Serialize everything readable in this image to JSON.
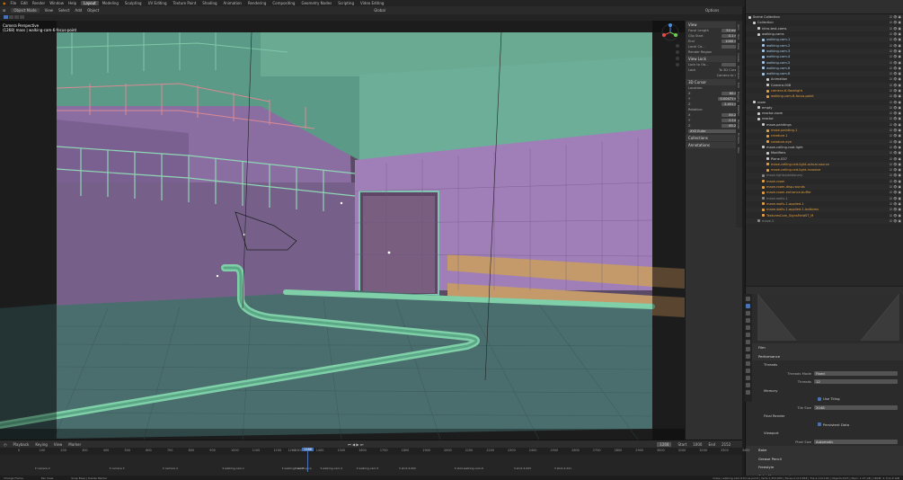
{
  "menu": {
    "items": [
      "File",
      "Edit",
      "Render",
      "Window",
      "Help"
    ],
    "workspaces": [
      "Layout",
      "Modeling",
      "Sculpting",
      "UV Editing",
      "Texture Paint",
      "Shading",
      "Animation",
      "Rendering",
      "Compositing",
      "Geometry Nodes",
      "Scripting",
      "Video Editing"
    ],
    "active_workspace": "Layout",
    "scene_label": "Scene",
    "view_layer_label": "part 1"
  },
  "viewport_header": {
    "mode": "Object Mode",
    "menus": [
      "View",
      "Select",
      "Add",
      "Object"
    ],
    "transform": "Global",
    "options": "Options"
  },
  "viewport": {
    "camera_name": "Camera Perspective",
    "camera_path": "(1268) mass | walking-cam-6-focus-point"
  },
  "npanel": {
    "view_header": "View",
    "focal_label": "Focal Length",
    "focal_value": "50 mm",
    "clip_start_label": "Clip Start",
    "clip_start_value": "0.1 m",
    "end_label": "End",
    "end_value": "1000 m",
    "local_camera_label": "Local Ca...",
    "render_region_label": "Render Region",
    "view_lock_header": "View Lock",
    "lock_to_object_label": "Lock to Ob...",
    "lock_label": "Lock",
    "to_3d_cursor_label": "To 3D Cursor",
    "camera_to_view_label": "Camera to V...",
    "cursor_header": "3D Cursor",
    "location_label": "Location:",
    "x_value": "60 m",
    "y_value": "0.00471 m",
    "z_value": "2.451 m",
    "rotation_label": "Rotation:",
    "rx_value": "84.2°",
    "ry_value": "0.14°",
    "rz_value": "65.2°",
    "rotation_mode": "XYZ Euler",
    "collections_header": "Collections",
    "annotations_header": "Annotations",
    "tabs": [
      "Item",
      "Tool",
      "View",
      "Create",
      "Animation",
      "Edit",
      "Rigging",
      "Modifier",
      "Render",
      "Fit Parts",
      "Misc"
    ]
  },
  "outliner": {
    "items": [
      {
        "label": "Scene Collection",
        "color": "#cccccc",
        "indent": 0
      },
      {
        "label": "Collection",
        "color": "#cccccc",
        "indent": 1
      },
      {
        "label": "intro-test-cams",
        "color": "#cccccc",
        "indent": 2
      },
      {
        "label": "walking-cams",
        "color": "#cccccc",
        "indent": 2
      },
      {
        "label": "walking-cam-1",
        "color": "#a3c7e4",
        "indent": 3
      },
      {
        "label": "walking-cam-2",
        "color": "#a3c7e4",
        "indent": 3
      },
      {
        "label": "walking-cam-3",
        "color": "#a3c7e4",
        "indent": 3
      },
      {
        "label": "walking-cam-4",
        "color": "#a3c7e4",
        "indent": 3
      },
      {
        "label": "walking-cam-5",
        "color": "#a3c7e4",
        "indent": 3
      },
      {
        "label": "walking-cam-6",
        "color": "#a3c7e4",
        "indent": 3
      },
      {
        "label": "walking-cam-8",
        "color": "#a3c7e4",
        "indent": 3
      },
      {
        "label": "Animation",
        "color": "#cccccc",
        "indent": 4
      },
      {
        "label": "Camera.008",
        "color": "#cccccc",
        "indent": 4
      },
      {
        "label": "camera-6-flashlight",
        "color": "#e6a040",
        "indent": 4
      },
      {
        "label": "walking-cam-6-focus-point",
        "color": "#e6a040",
        "indent": 4
      },
      {
        "label": "room",
        "color": "#cccccc",
        "indent": 1
      },
      {
        "label": "empty",
        "color": "#cccccc",
        "indent": 2
      },
      {
        "label": "reactor-room",
        "color": "#cccccc",
        "indent": 2
      },
      {
        "label": "reactor",
        "color": "#cccccc",
        "indent": 2
      },
      {
        "label": "maze-paintings",
        "color": "#cccccc",
        "indent": 3
      },
      {
        "label": "maze-painting-1",
        "color": "#e6a040",
        "indent": 4
      },
      {
        "label": "creature-1",
        "color": "#e6a040",
        "indent": 4
      },
      {
        "label": "creature-eye",
        "color": "#e6a040",
        "indent": 4
      },
      {
        "label": "maze-ceiling-root-light",
        "color": "#cccccc",
        "indent": 3
      },
      {
        "label": "Modifiers",
        "color": "#cccccc",
        "indent": 4
      },
      {
        "label": "Plane.037",
        "color": "#cccccc",
        "indent": 4
      },
      {
        "label": "maze-ceiling-red-light-actual-source",
        "color": "#e6a040",
        "indent": 4
      },
      {
        "label": "maze-ceiling-red-light-invasive",
        "color": "#e6a040",
        "indent": 4
      },
      {
        "label": "maze-lights/stationary",
        "color": "#888888",
        "indent": 3
      },
      {
        "label": "maze-room",
        "color": "#e6a040",
        "indent": 3
      },
      {
        "label": "maze-room-disp-rounds",
        "color": "#e6a040",
        "indent": 3
      },
      {
        "label": "maze-room-entrance-buffer",
        "color": "#e6a040",
        "indent": 3
      },
      {
        "label": "maze-walls-1",
        "color": "#888888",
        "indent": 3
      },
      {
        "label": "maze-walls-1-applied-1",
        "color": "#e6a040",
        "indent": 3
      },
      {
        "label": "maze-walls-1-applied-1-bottoms",
        "color": "#e6a040",
        "indent": 3
      },
      {
        "label": "TexturesCom_SignsFieldST_M",
        "color": "#e6a040",
        "indent": 3
      },
      {
        "label": "maze-2",
        "color": "#888888",
        "indent": 2
      }
    ]
  },
  "properties": {
    "sections": [
      {
        "type": "sec",
        "label": "Film"
      },
      {
        "type": "sec",
        "label": "Performance"
      },
      {
        "type": "sub",
        "label": "Threads"
      },
      {
        "type": "field",
        "label": "Threads Mode",
        "value": "Fixed"
      },
      {
        "type": "field",
        "label": "Threads",
        "value": "12"
      },
      {
        "type": "sub",
        "label": "Memory"
      },
      {
        "type": "check",
        "label": "Use Tiling"
      },
      {
        "type": "field",
        "label": "Tile Size",
        "value": "2048"
      },
      {
        "type": "sub",
        "label": "Final Render"
      },
      {
        "type": "check",
        "label": "Persistent Data"
      },
      {
        "type": "sub",
        "label": "Viewport"
      },
      {
        "type": "field",
        "label": "Pixel Size",
        "value": "Automatic"
      },
      {
        "type": "sec",
        "label": "Bake"
      },
      {
        "type": "sec",
        "label": "Grease Pencil"
      },
      {
        "type": "sec",
        "label": "Freestyle"
      },
      {
        "type": "sec",
        "label": "Color Management"
      }
    ]
  },
  "timeline": {
    "menus": [
      "Playback",
      "Keying",
      "View",
      "Marker"
    ],
    "current_frame": "1268",
    "start_label": "Start",
    "start_value": "1000",
    "end_label": "End",
    "end_value": "2152",
    "ticks": [
      "0",
      "100",
      "200",
      "300",
      "400",
      "500",
      "600",
      "700",
      "800",
      "900",
      "1000",
      "1100",
      "1200",
      "1268",
      "1300",
      "1400",
      "1500",
      "1600",
      "1700",
      "1800",
      "1900",
      "2000",
      "2100",
      "2200",
      "2300",
      "2400",
      "2500",
      "2600",
      "2700",
      "2800",
      "2900",
      "3000",
      "3100",
      "3200",
      "3300",
      "3400"
    ],
    "markers": [
      {
        "label": "camera 2",
        "frame": 80
      },
      {
        "label": "camera 3",
        "frame": 430
      },
      {
        "label": "camera 4",
        "frame": 680
      },
      {
        "label": "walking-cam-1",
        "frame": 960
      },
      {
        "label": "walking-cam-3",
        "frame": 1240
      },
      {
        "label": "walking-ca",
        "frame": 1300
      },
      {
        "label": "walking-cam-4",
        "frame": 1420
      },
      {
        "label": "walking-cam-5",
        "frame": 1590
      },
      {
        "label": "shot-4-002",
        "frame": 1790
      },
      {
        "label": "shot-walking-cam-6",
        "frame": 2050
      },
      {
        "label": "shot-4-003",
        "frame": 2330
      },
      {
        "label": "shot-4-221",
        "frame": 2520
      }
    ]
  },
  "status_bar": {
    "left": "Change Frame",
    "mid": "Pan View",
    "mid2": "Snap Base | Delete Marker",
    "right": "mass | walking-cam-6-focus-point | Verts:1,352,684 | Faces:2,113,658 | Tris:4,113,102 | Objects:0/23 | Mem: 1.07 GB | VRAM: 4.7/11.6 GiB"
  },
  "colors": {
    "wall_purple": "#9a78b4",
    "pipe_green": "#7fd0a8",
    "accent_blue": "#4772b3",
    "floor_teal": "#47696a"
  }
}
